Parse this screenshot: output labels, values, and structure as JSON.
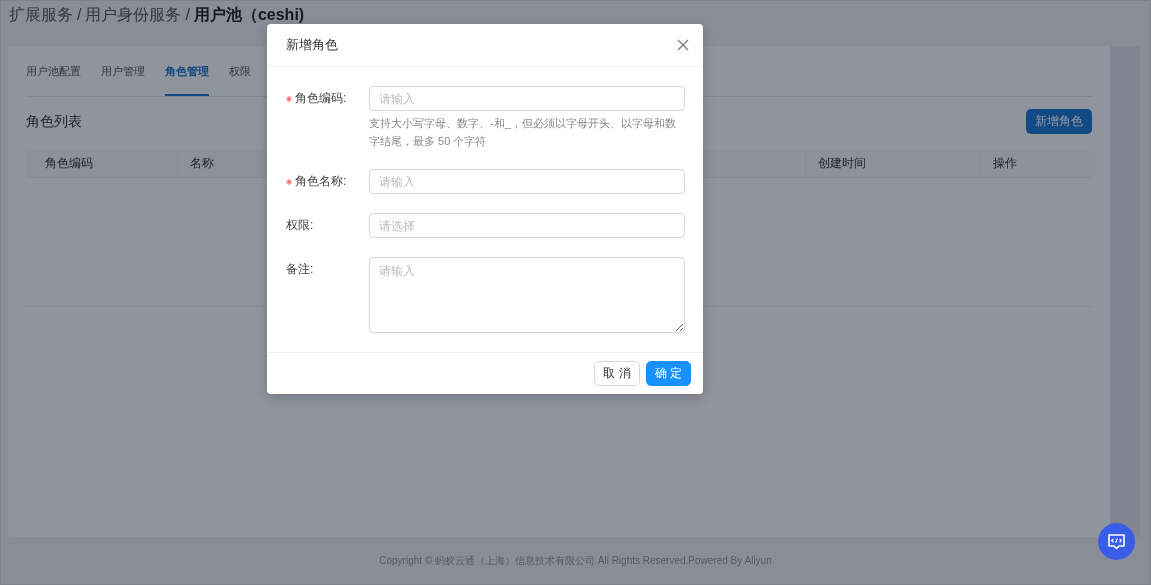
{
  "breadcrumb": [
    {
      "text": "扩展服务",
      "current": false,
      "separator": "/"
    },
    {
      "text": "用户身份服务",
      "current": false,
      "separator": "/"
    },
    {
      "text": "用户池（ceshi)",
      "current": true
    }
  ],
  "tabs": [
    {
      "label": "用户池配置",
      "selected": false
    },
    {
      "label": "用户管理",
      "selected": false
    },
    {
      "label": "角色管理",
      "selected": true
    },
    {
      "label": "权限",
      "selected": false
    }
  ],
  "section_title": "角色列表",
  "add_button": "新增角色",
  "table": {
    "columns": [
      "角色编码",
      "名称",
      "创建时间",
      "操作"
    ]
  },
  "dialog": {
    "title": "新增角色",
    "fields": [
      {
        "label": "角色编码:",
        "required": true,
        "kind": "input",
        "placeholder": "请输入",
        "help": "支持大小写字母、数字、-和_，但必须以字母开头、以字母和数字结尾，最多 50 个字符"
      },
      {
        "label": "角色名称:",
        "required": true,
        "kind": "input",
        "placeholder": "请输入"
      },
      {
        "label": "权限:",
        "required": false,
        "kind": "select",
        "placeholder": "请选择"
      },
      {
        "label": "备注:",
        "required": false,
        "kind": "textarea",
        "placeholder": "请输入"
      }
    ],
    "buttons": [
      {
        "label": "取 消",
        "kind": "default"
      },
      {
        "label": "确 定",
        "kind": "primary"
      }
    ]
  },
  "footer": "Copyright © 蚂蚁云通（上海）信息技术有限公司 All Rights Reserved.Powered By Aliyun"
}
